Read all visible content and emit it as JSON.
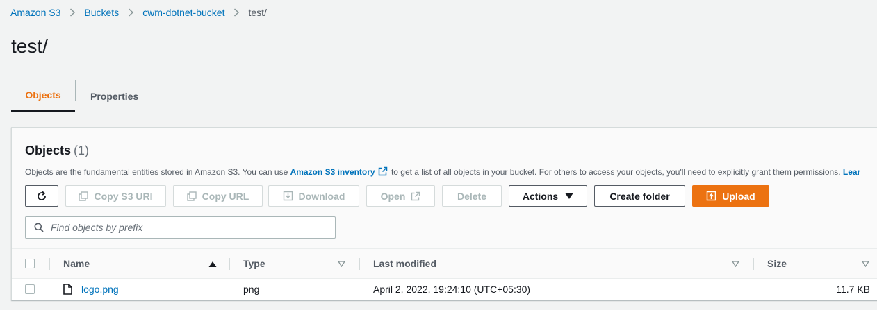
{
  "breadcrumb": {
    "items": [
      {
        "label": "Amazon S3"
      },
      {
        "label": "Buckets"
      },
      {
        "label": "cwm-dotnet-bucket"
      },
      {
        "label": "test/"
      }
    ]
  },
  "page": {
    "title": "test/"
  },
  "tabs": [
    {
      "label": "Objects",
      "active": true
    },
    {
      "label": "Properties",
      "active": false
    }
  ],
  "objects_panel": {
    "heading": "Objects",
    "count": "(1)",
    "description_before": "Objects are the fundamental entities stored in Amazon S3. You can use ",
    "description_link": "Amazon S3 inventory",
    "description_after": " to get a list of all objects in your bucket. For others to access your objects, you'll need to explicitly grant them permissions. ",
    "description_learn": "Lear"
  },
  "toolbar": {
    "copy_uri": "Copy S3 URI",
    "copy_url": "Copy URL",
    "download": "Download",
    "open": "Open",
    "delete": "Delete",
    "actions": "Actions",
    "create_folder": "Create folder",
    "upload": "Upload"
  },
  "search": {
    "placeholder": "Find objects by prefix",
    "value": ""
  },
  "table": {
    "columns": [
      "Name",
      "Type",
      "Last modified",
      "Size"
    ],
    "rows": [
      {
        "name": "logo.png",
        "type": "png",
        "last_modified": "April 2, 2022, 19:24:10 (UTC+05:30)",
        "size": "11.7 KB"
      }
    ]
  },
  "colors": {
    "accent": "#ec7211",
    "link": "#0073bb",
    "text": "#16191f"
  }
}
